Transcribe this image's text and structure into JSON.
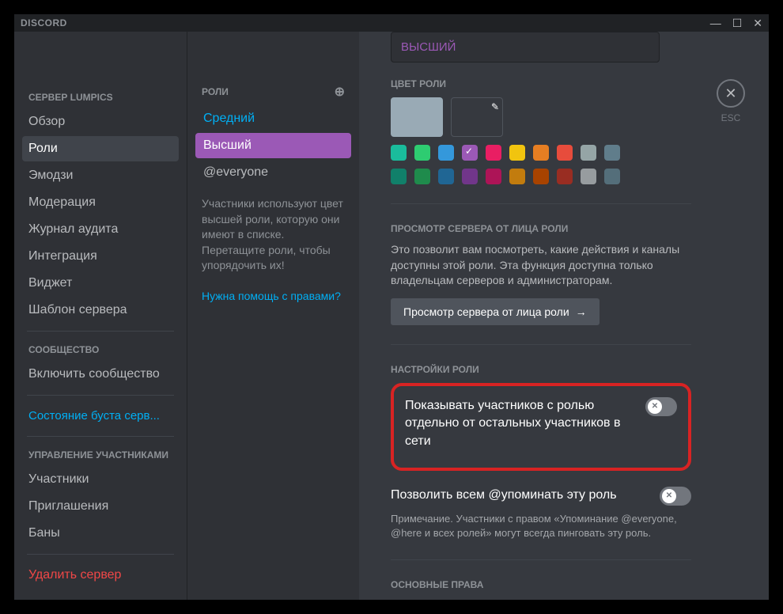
{
  "titlebar": {
    "title": "DISCORD"
  },
  "sidebar": {
    "server_header": "СЕРВЕР LUMPICS",
    "items": [
      "Обзор",
      "Роли",
      "Эмодзи",
      "Модерация",
      "Журнал аудита",
      "Интеграция",
      "Виджет",
      "Шаблон сервера"
    ],
    "community_header": "СООБЩЕСТВО",
    "community_item": "Включить сообщество",
    "boost_status": "Состояние буста серв...",
    "members_header": "УПРАВЛЕНИЕ УЧАСТНИКАМИ",
    "members_items": [
      "Участники",
      "Приглашения",
      "Баны"
    ],
    "delete_server": "Удалить сервер"
  },
  "roles": {
    "header": "РОЛИ",
    "items": [
      "Средний",
      "Высший",
      "@everyone"
    ],
    "help_text": "Участники используют цвет высшей роли, которую они имеют в списке. Перетащите роли, чтобы упорядочить их!",
    "help_link": "Нужна помощь с правами?"
  },
  "main": {
    "dropdown_value": "ВЫСШИЙ",
    "color_label": "ЦВЕТ РОЛИ",
    "default_color": "#99aab5",
    "swatches_row1": [
      "#1abc9c",
      "#2ecc71",
      "#3498db",
      "#9b59b6",
      "#e91e63",
      "#f1c40f",
      "#e67e22",
      "#e74c3c",
      "#95a5a6",
      "#607d8b"
    ],
    "swatches_row2": [
      "#11806a",
      "#1f8b4c",
      "#206694",
      "#71368a",
      "#ad1457",
      "#c27c0e",
      "#a84300",
      "#992d22",
      "#979c9f",
      "#546e7a"
    ],
    "preview_header": "ПРОСМОТР СЕРВЕРА ОТ ЛИЦА РОЛИ",
    "preview_desc": "Это позволит вам посмотреть, какие действия и каналы доступны этой роли. Эта функция доступна только владельцам серверов и администраторам.",
    "preview_button": "Просмотр сервера от лица роли",
    "settings_header": "НАСТРОЙКИ РОЛИ",
    "setting_separate": "Показывать участников с ролью отдельно от остальных участников в сети",
    "setting_mention": "Позволить всем @упоминать эту роль",
    "setting_mention_note": "Примечание. Участники с правом «Упоминание @everyone, @here и всех ролей» могут всегда пинговать эту роль.",
    "general_perms": "ОСНОВНЫЕ ПРАВА",
    "esc_label": "ESC"
  }
}
